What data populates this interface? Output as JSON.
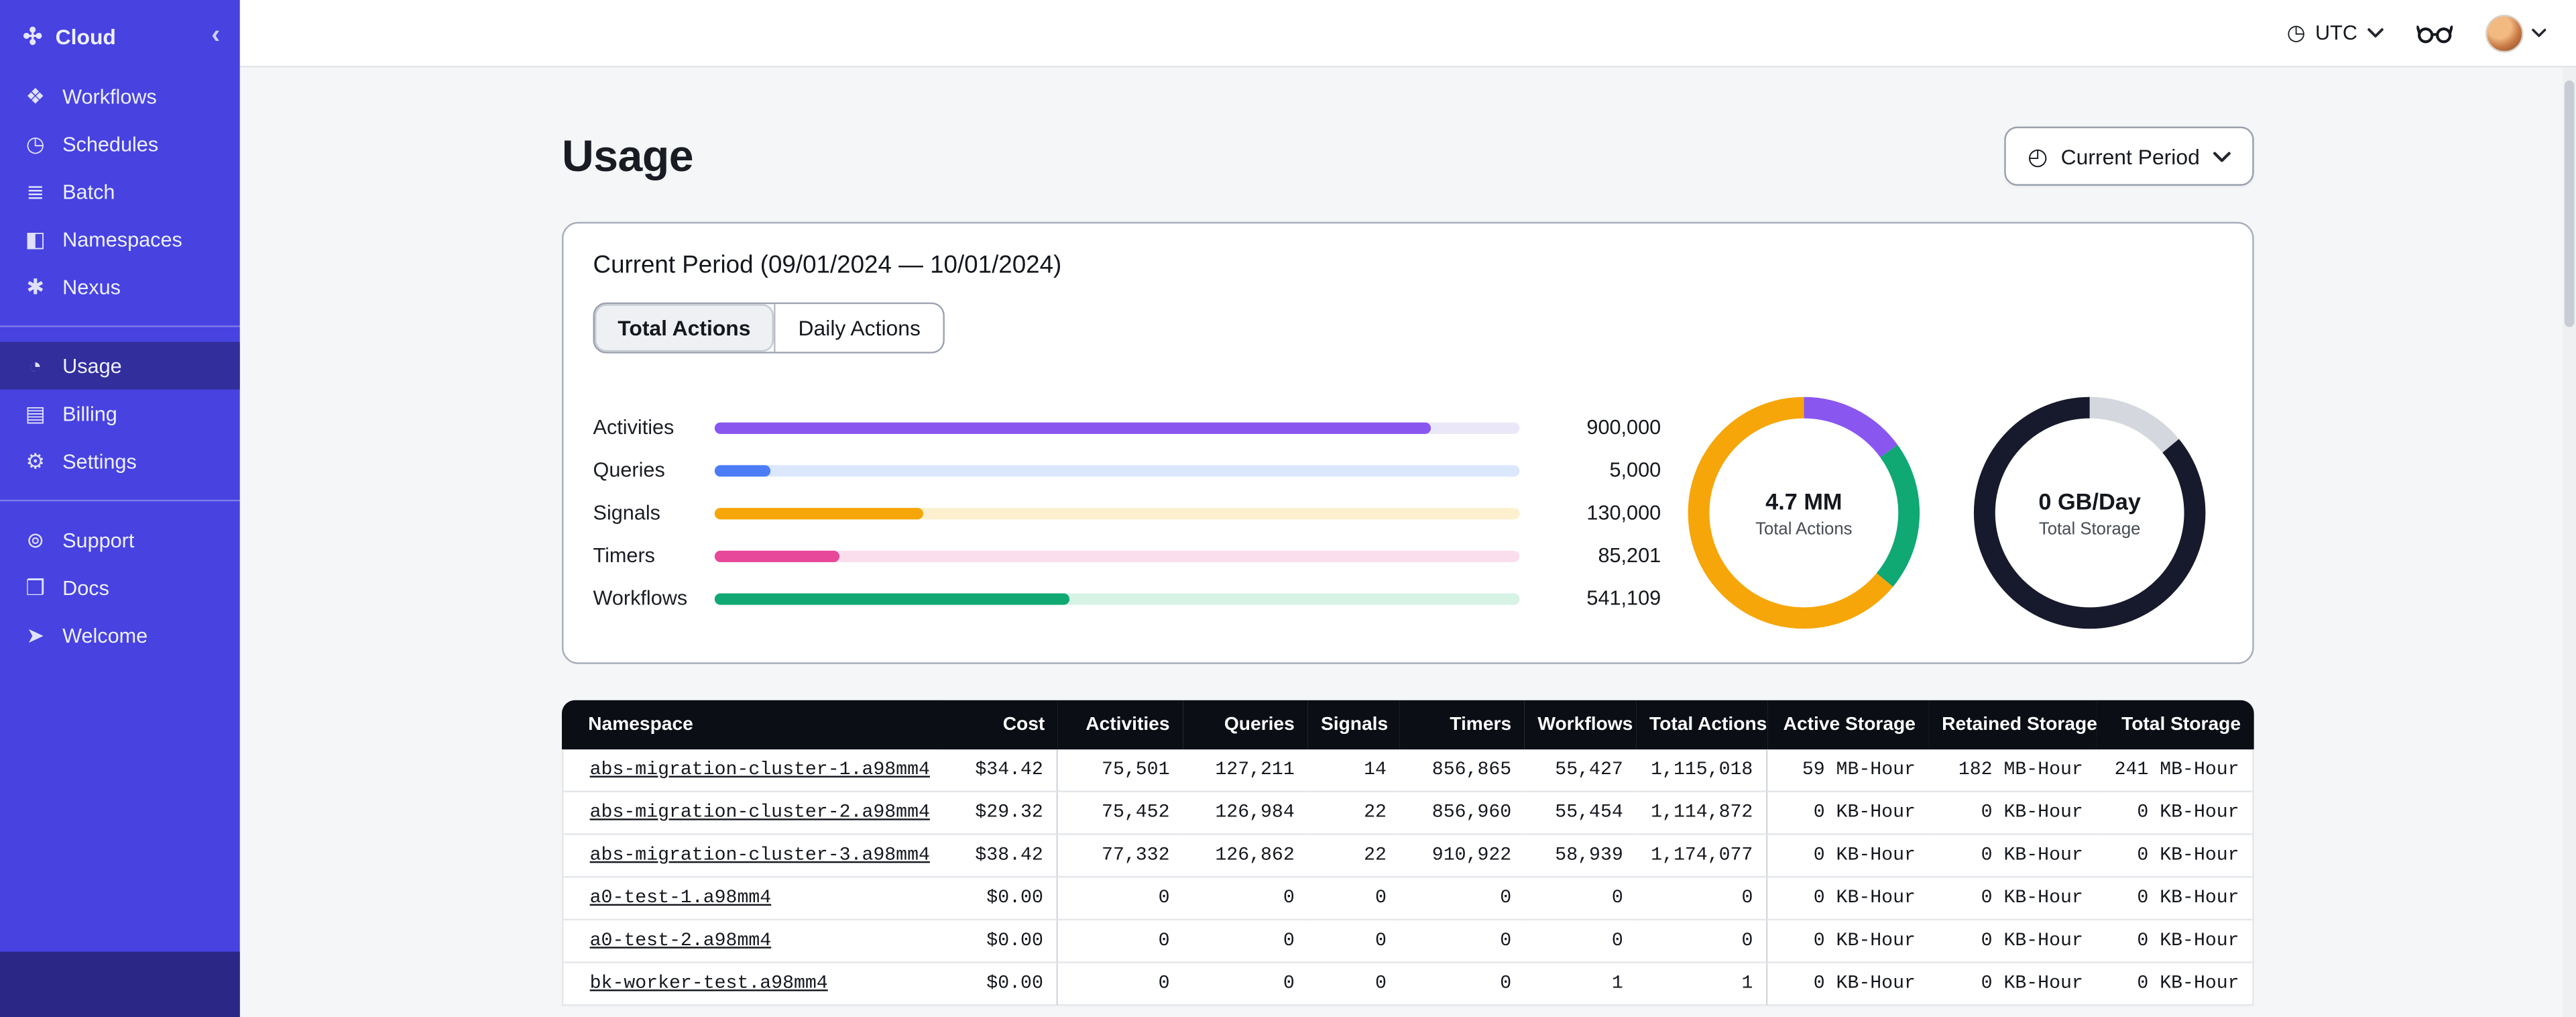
{
  "icons": {
    "brand": "✣",
    "collapse": "‹",
    "clock": "◷",
    "stopwatch": "◴"
  },
  "sidebar": {
    "brand": {
      "label": "Cloud",
      "icon": "temporal-cloud-logo-icon"
    },
    "groups": [
      {
        "items": [
          {
            "label": "Workflows",
            "icon": "workflows-icon",
            "glyph": "❖"
          },
          {
            "label": "Schedules",
            "icon": "schedules-icon",
            "glyph": "◷"
          },
          {
            "label": "Batch",
            "icon": "batch-icon",
            "glyph": "≣"
          },
          {
            "label": "Namespaces",
            "icon": "namespaces-icon",
            "glyph": "◧"
          },
          {
            "label": "Nexus",
            "icon": "nexus-icon",
            "glyph": "✱"
          }
        ]
      },
      {
        "items": [
          {
            "label": "Usage",
            "icon": "usage-icon",
            "glyph": "◔",
            "active": true
          },
          {
            "label": "Billing",
            "icon": "billing-icon",
            "glyph": "▤"
          },
          {
            "label": "Settings",
            "icon": "settings-icon",
            "glyph": "⚙"
          }
        ]
      },
      {
        "items": [
          {
            "label": "Support",
            "icon": "support-icon",
            "glyph": "⊚"
          },
          {
            "label": "Docs",
            "icon": "docs-icon",
            "glyph": "❒"
          },
          {
            "label": "Welcome",
            "icon": "welcome-icon",
            "glyph": "➤"
          }
        ]
      }
    ]
  },
  "topbar": {
    "timezone": "UTC"
  },
  "page": {
    "title": "Usage",
    "period_button": "Current Period"
  },
  "usage_card": {
    "title": "Current Period (09/01/2024 — 10/01/2024)",
    "tabs": [
      {
        "label": "Total Actions",
        "active": true
      },
      {
        "label": "Daily Actions",
        "active": false
      }
    ]
  },
  "chart_data": [
    {
      "type": "bar",
      "orientation": "horizontal",
      "title": "Total Actions breakdown",
      "categories": [
        "Activities",
        "Queries",
        "Signals",
        "Timers",
        "Workflows"
      ],
      "values": [
        900000,
        5000,
        130000,
        85201,
        541109
      ],
      "value_labels": [
        "900,000",
        "5,000",
        "130,000",
        "85,201",
        "541,109"
      ],
      "bar_percent_of_track": [
        89,
        7,
        26,
        15.5,
        44
      ],
      "colors": [
        "#8a56f0",
        "#4a7df5",
        "#f6a609",
        "#e8489a",
        "#10a873"
      ],
      "track_colors": [
        "#eae8f8",
        "#dbe7fd",
        "#fcf0ce",
        "#fbdeee",
        "#d7f3e6"
      ],
      "grid": false,
      "legend": "none"
    },
    {
      "type": "pie",
      "subtype": "donut",
      "center_value": "4.7 MM",
      "center_label": "Total Actions",
      "segments": [
        {
          "color": "#8a56f0",
          "fraction": 0.15
        },
        {
          "color": "#10a873",
          "fraction": 0.21
        },
        {
          "color": "#f6a609",
          "fraction": 0.64
        }
      ]
    },
    {
      "type": "pie",
      "subtype": "donut",
      "center_value": "0 GB/Day",
      "center_label": "Total Storage",
      "segments": [
        {
          "color": "#d4d7dd",
          "fraction": 0.14
        },
        {
          "color": "#171a2c",
          "fraction": 0.86
        }
      ]
    }
  ],
  "table": {
    "columns": [
      "Namespace",
      "Cost",
      "Activities",
      "Queries",
      "Signals",
      "Timers",
      "Workflows",
      "Total Actions",
      "Active Storage",
      "Retained Storage",
      "Total Storage"
    ],
    "rows": [
      [
        "abs-migration-cluster-1.a98mm4",
        "$34.42",
        "75,501",
        "127,211",
        "14",
        "856,865",
        "55,427",
        "1,115,018",
        "59 MB-Hour",
        "182 MB-Hour",
        "241 MB-Hour"
      ],
      [
        "abs-migration-cluster-2.a98mm4",
        "$29.32",
        "75,452",
        "126,984",
        "22",
        "856,960",
        "55,454",
        "1,114,872",
        "0 KB-Hour",
        "0 KB-Hour",
        "0 KB-Hour"
      ],
      [
        "abs-migration-cluster-3.a98mm4",
        "$38.42",
        "77,332",
        "126,862",
        "22",
        "910,922",
        "58,939",
        "1,174,077",
        "0 KB-Hour",
        "0 KB-Hour",
        "0 KB-Hour"
      ],
      [
        "a0-test-1.a98mm4",
        "$0.00",
        "0",
        "0",
        "0",
        "0",
        "0",
        "0",
        "0 KB-Hour",
        "0 KB-Hour",
        "0 KB-Hour"
      ],
      [
        "a0-test-2.a98mm4",
        "$0.00",
        "0",
        "0",
        "0",
        "0",
        "0",
        "0",
        "0 KB-Hour",
        "0 KB-Hour",
        "0 KB-Hour"
      ],
      [
        "bk-worker-test.a98mm4",
        "$0.00",
        "0",
        "0",
        "0",
        "0",
        "1",
        "1",
        "0 KB-Hour",
        "0 KB-Hour",
        "0 KB-Hour"
      ]
    ]
  }
}
